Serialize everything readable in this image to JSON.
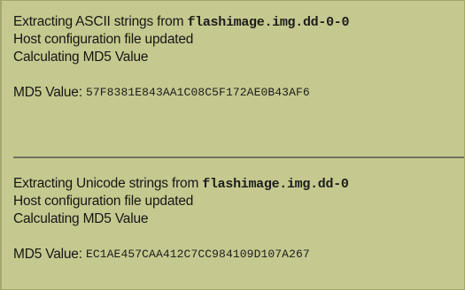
{
  "log": {
    "blocks": [
      {
        "extract_prefix": "Extracting ASCII strings from ",
        "extract_file": "flashimage.img.dd-0-0",
        "host_config": "Host configuration file updated",
        "calculating": "Calculating MD5 Value",
        "md5_label": "MD5 Value: ",
        "md5_value": "57F8381E843AA1C08C5F172AE0B43AF6"
      },
      {
        "extract_prefix": "Extracting Unicode strings from ",
        "extract_file": "flashimage.img.dd-0",
        "host_config": "Host configuration file updated",
        "calculating": "Calculating MD5 Value",
        "md5_label": "MD5 Value: ",
        "md5_value": "EC1AE457CAA412C7CC984109D107A267"
      }
    ]
  },
  "colors": {
    "panel_background": "#c6c98f",
    "separator": "#6e715c",
    "text": "#161616"
  }
}
